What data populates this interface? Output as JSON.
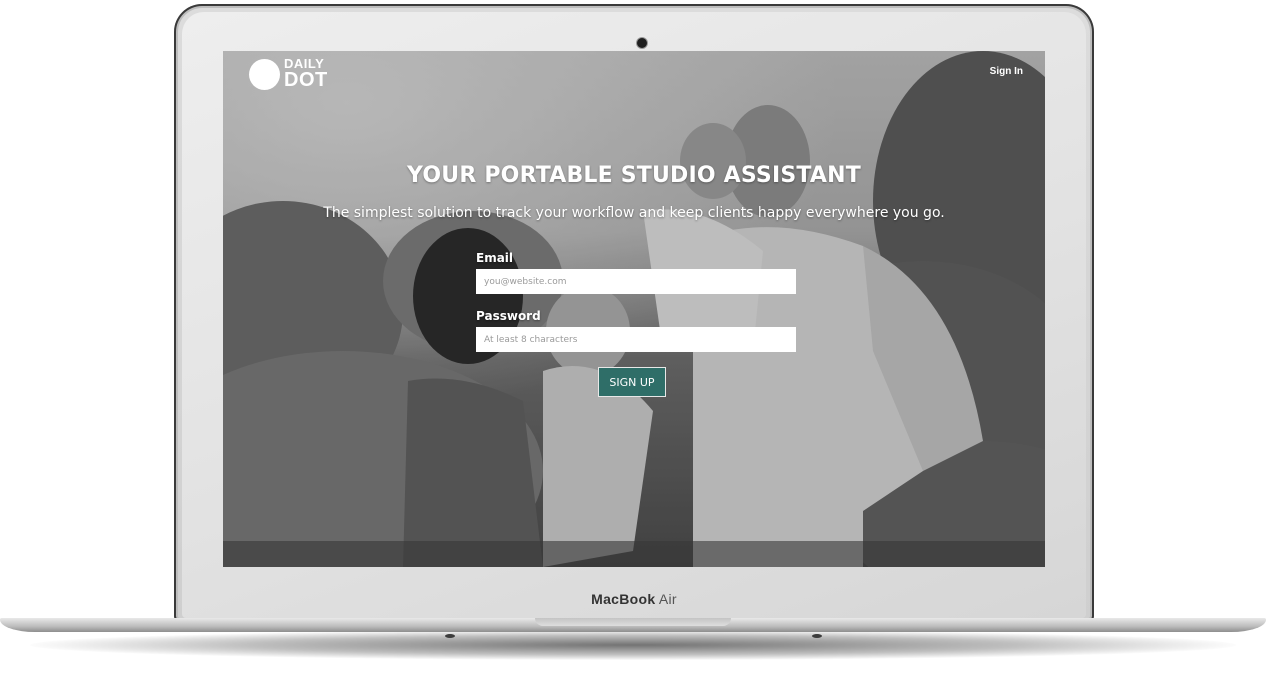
{
  "device": {
    "brand_bold": "MacBook",
    "brand_light": "Air"
  },
  "header": {
    "logo_top": "DAILY",
    "logo_bottom": "DOT",
    "signin_label": "Sign In"
  },
  "hero": {
    "headline": "YOUR PORTABLE STUDIO ASSISTANT",
    "subline": "The simplest solution to track your workflow and keep clients happy everywhere you go."
  },
  "form": {
    "email_label": "Email",
    "email_placeholder": "you@website.com",
    "password_label": "Password",
    "password_placeholder": "At least 8 characters",
    "submit_label": "SIGN UP"
  },
  "colors": {
    "accent": "#2f6e68"
  }
}
